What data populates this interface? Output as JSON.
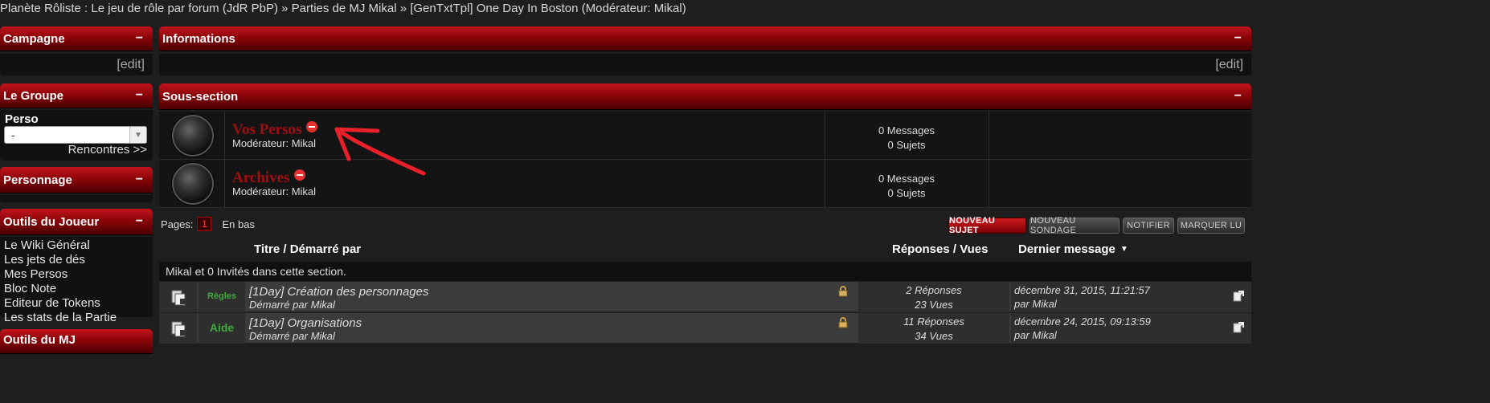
{
  "breadcrumb": "Planète Rôliste : Le jeu de rôle par forum (JdR PbP) » Parties de MJ Mikal » [GenTxtTpl] One Day In Boston (Modérateur: Mikal)",
  "sidebar": {
    "campagne": {
      "title": "Campagne",
      "toggle": "−",
      "edit": "[edit]"
    },
    "groupe": {
      "title": "Le Groupe",
      "toggle": "−",
      "perso_label": "Perso",
      "perso_value": "-",
      "rencontres": "Rencontres >>"
    },
    "personnage": {
      "title": "Personnage",
      "toggle": "−"
    },
    "outils_joueur": {
      "title": "Outils du Joueur",
      "toggle": "−",
      "links": [
        "Le Wiki Général",
        "Les jets de dés",
        "Mes Persos",
        "Bloc Note",
        "Editeur de Tokens",
        "Les stats de la Partie"
      ]
    },
    "outils_mj": {
      "title": "Outils du MJ"
    }
  },
  "informations": {
    "title": "Informations",
    "toggle": "−",
    "edit": "[edit]"
  },
  "sous_section": {
    "title": "Sous-section",
    "toggle": "−",
    "boards": [
      {
        "name": "Vos Persos",
        "moderator_label": "Modérateur:",
        "moderator": "Mikal",
        "messages": "0 Messages",
        "sujets": "0 Sujets"
      },
      {
        "name": "Archives",
        "moderator_label": "Modérateur:",
        "moderator": "Mikal",
        "messages": "0 Messages",
        "sujets": "0 Sujets"
      }
    ]
  },
  "pagination": {
    "label": "Pages:",
    "current": "1",
    "en_bas": "En bas"
  },
  "buttons": {
    "nouveau_sujet": "NOUVEAU SUJET",
    "nouveau_sondage": "NOUVEAU SONDAGE",
    "notifier": "NOTIFIER",
    "marquer_lu": "MARQUER LU"
  },
  "columns": {
    "titre": "Titre / Démarré par",
    "reponses": "Réponses / Vues",
    "dernier": "Dernier message"
  },
  "whos_here": {
    "user": "Mikal",
    "text": "et 0 Invités dans cette section."
  },
  "topics": [
    {
      "tag": "Règles",
      "title": "[1Day] Création des personnages",
      "started_label": "Démarré par",
      "author": "Mikal",
      "replies": "2 Réponses",
      "views": "23 Vues",
      "last_date": "décembre 31, 2015, 11:21:57",
      "last_by_label": "par",
      "last_by": "Mikal"
    },
    {
      "tag": "Aide",
      "title": "[1Day] Organisations",
      "started_label": "Démarré par",
      "author": "Mikal",
      "replies": "11 Réponses",
      "views": "34 Vues",
      "last_date": "décembre 24, 2015, 09:13:59",
      "last_by_label": "par",
      "last_by": "Mikal"
    }
  ],
  "colors": {
    "accent_red": "#a10d10",
    "tag_green": "#3ea83e",
    "annotation_red": "#e8202a"
  }
}
